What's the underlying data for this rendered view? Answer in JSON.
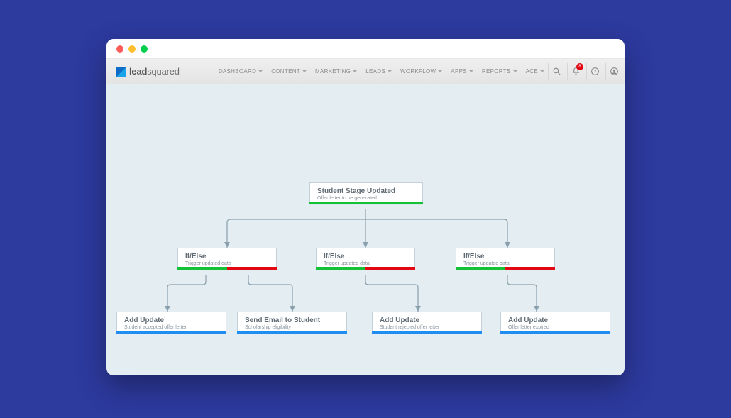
{
  "logo": {
    "prefix": "lead",
    "suffix": "squared"
  },
  "nav": {
    "items": [
      {
        "label": "DASHBOARD"
      },
      {
        "label": "CONTENT"
      },
      {
        "label": "MARKETING"
      },
      {
        "label": "LEADS"
      },
      {
        "label": "WORKFLOW"
      },
      {
        "label": "APPS"
      },
      {
        "label": "REPORTS"
      },
      {
        "label": "ACE"
      }
    ],
    "notification_badge": "8"
  },
  "workflow": {
    "trigger": {
      "title": "Student Stage Updated",
      "subtitle": "Offer letter to be generated"
    },
    "ifelse": [
      {
        "title": "If/Else",
        "subtitle": "Trigger updated data"
      },
      {
        "title": "If/Else",
        "subtitle": "Trigger updated data"
      },
      {
        "title": "If/Else",
        "subtitle": "Trigger updated data"
      }
    ],
    "actions": [
      {
        "title": "Add Update",
        "subtitle": "Student accepted offer letter"
      },
      {
        "title": "Send Email to Student",
        "subtitle": "Scholarship eligibility"
      },
      {
        "title": "Add Update",
        "subtitle": "Student rejected offer letter"
      },
      {
        "title": "Add Update",
        "subtitle": "Offer letter expired"
      }
    ]
  }
}
